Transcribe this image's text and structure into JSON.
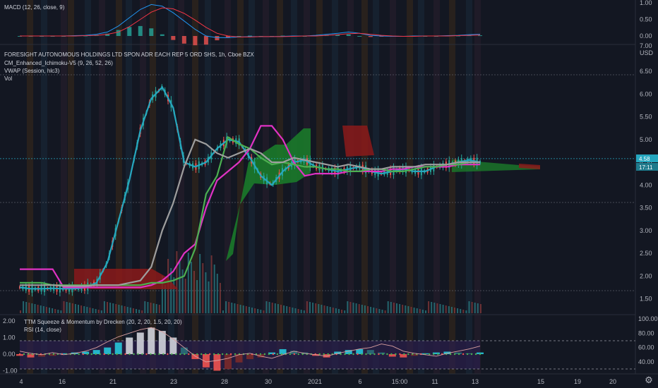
{
  "macd": {
    "label": "MACD (12, 26, close, 9)",
    "ticks": [
      "1.00",
      "0.50",
      "0.00"
    ],
    "tick_values": [
      1.0,
      0.5,
      0.0
    ]
  },
  "main": {
    "title": "FORESIGHT AUTONOMOUS HOLDINGS LTD SPON ADR EACH REP 5 ORD SHS, 1h, Cboe BZX",
    "ind1": "CM_Enhanced_Ichimoku-V5 (9, 26, 52, 26)",
    "ind2": "VWAP (Session, hlc3)",
    "ind3": "Vol",
    "axis_top": "7.00",
    "unit": "USD",
    "ticks": [
      "6.50",
      "6.00",
      "5.50",
      "5.00",
      "4.50",
      "4.00",
      "3.50",
      "3.00",
      "2.50",
      "2.00",
      "1.50"
    ],
    "tick_values": [
      6.5,
      6.0,
      5.5,
      5.0,
      4.5,
      4.0,
      3.5,
      3.0,
      2.5,
      2.0,
      1.5
    ],
    "price_tag": "4.58",
    "price_value": 4.58,
    "time_tag": "17:11"
  },
  "lower": {
    "label1": "TTM Squeeze & Momentum by Drecken (20, 2, 20, 1.5, 20, 20)",
    "label2": "RSI (14, close)",
    "left_ticks": [
      "2.00",
      "1.00",
      "0.00",
      "-1.00"
    ],
    "left_tick_values": [
      2.0,
      1.0,
      0.0,
      -1.0
    ],
    "right_ticks": [
      "100.00",
      "80.00",
      "60.00",
      "40.00"
    ],
    "right_tick_values": [
      100,
      80,
      60,
      40
    ],
    "rsi_bands": [
      70,
      30
    ]
  },
  "xaxis": [
    "4",
    "16",
    "21",
    "23",
    "28",
    "30",
    "2021",
    "6",
    "15:00",
    "11",
    "13",
    "15",
    "19",
    "20"
  ],
  "colors": {
    "background": "#131722",
    "cyan": "#26a7bf",
    "magenta": "#e032c4",
    "green": "#4caf50",
    "gray": "#9e9e9e",
    "cloud_green": "#1b7a2a",
    "cloud_red": "#8b1a1a",
    "macd_line": "#2196f3",
    "signal_line": "#f23645",
    "rsi_line": "#d9a0a0"
  },
  "chart_data": [
    {
      "type": "line",
      "title": "FORESIGHT AUTONOMOUS HOLDINGS LTD SPON ADR EACH REP 5 ORD SHS, 1h, Cboe BZX",
      "x_labels": [
        "4",
        "16",
        "21",
        "23",
        "28",
        "30",
        "2021",
        "6",
        "15:00",
        "11",
        "13",
        "15",
        "19",
        "20"
      ],
      "ylim": [
        1.3,
        7.0
      ],
      "series": [
        {
          "name": "",
          "color": "#26a7bf",
          "values": [
            1.75,
            1.72,
            1.72,
            1.73,
            1.72,
            1.72,
            1.75,
            1.85,
            2.3,
            3.2,
            4.1,
            5.2,
            5.9,
            6.15,
            5.7,
            4.5,
            4.4,
            4.5,
            4.8,
            5.0,
            4.95,
            4.6,
            4.2,
            4.0,
            4.3,
            4.5,
            4.55,
            4.4,
            4.35,
            4.3,
            4.35,
            4.4,
            4.3,
            4.25,
            4.3,
            4.35,
            4.3,
            4.3,
            4.4,
            4.45,
            4.5,
            4.55,
            4.5
          ]
        },
        {
          "name": "",
          "color": "#e032c4",
          "values": [
            2.15,
            2.15,
            2.15,
            2.15,
            1.75,
            1.75,
            1.75,
            1.75,
            1.75,
            1.75,
            1.75,
            1.75,
            1.8,
            1.9,
            2.1,
            2.5,
            2.7,
            3.5,
            4.1,
            4.3,
            4.5,
            4.8,
            5.3,
            5.3,
            5.0,
            4.5,
            4.2,
            4.25,
            4.25,
            4.25,
            4.3,
            4.3,
            4.3,
            4.3,
            4.35,
            4.35,
            4.4,
            4.4,
            4.4,
            4.4,
            4.45,
            4.45,
            4.45
          ]
        },
        {
          "name": "",
          "color": "#4caf50",
          "values": [
            1.85,
            1.85,
            1.85,
            1.8,
            1.8,
            1.8,
            1.8,
            1.8,
            1.8,
            1.8,
            1.8,
            1.8,
            1.85,
            1.85,
            1.9,
            2.0,
            2.6,
            3.8,
            4.2,
            5.05,
            4.9,
            4.8,
            4.6,
            4.45,
            4.5,
            4.45,
            4.4,
            4.4,
            4.35,
            4.35,
            4.3,
            4.3,
            4.35,
            4.35,
            4.3,
            4.3,
            4.35,
            4.4,
            4.4,
            4.45,
            4.45,
            4.5,
            4.5
          ]
        },
        {
          "name": "",
          "color": "#9e9e9e",
          "values": [
            1.8,
            1.8,
            1.8,
            1.8,
            1.78,
            1.78,
            1.78,
            1.8,
            1.8,
            1.8,
            1.85,
            1.9,
            2.2,
            3.0,
            3.6,
            4.4,
            5.0,
            4.9,
            4.7,
            4.6,
            4.7,
            4.8,
            4.7,
            4.5,
            4.5,
            4.6,
            4.55,
            4.5,
            4.45,
            4.4,
            4.45,
            4.4,
            4.35,
            4.35,
            4.4,
            4.4,
            4.4,
            4.45,
            4.45,
            4.45,
            4.5,
            4.5,
            4.5
          ]
        }
      ]
    },
    {
      "type": "line",
      "title": "MACD (12, 26, close, 9)",
      "ylim": [
        -0.15,
        1.0
      ],
      "series": [
        {
          "name": "",
          "color": "#2196f3",
          "values": [
            0.0,
            0.0,
            0.0,
            0.0,
            0.0,
            0.01,
            0.02,
            0.05,
            0.12,
            0.3,
            0.55,
            0.8,
            0.95,
            0.9,
            0.7,
            0.45,
            0.2,
            0.0,
            -0.05,
            -0.05,
            -0.03,
            -0.02,
            -0.02,
            -0.02,
            -0.01,
            0.0,
            0.0,
            0.02,
            0.05,
            0.08,
            0.12,
            0.08,
            0.02,
            0.0,
            -0.01,
            -0.01,
            0.0,
            0.0,
            0.0,
            0.01,
            0.02,
            0.04,
            0.05
          ]
        },
        {
          "name": "",
          "color": "#f23645",
          "values": [
            0.0,
            0.0,
            0.0,
            0.0,
            0.0,
            0.0,
            0.01,
            0.02,
            0.05,
            0.12,
            0.28,
            0.5,
            0.72,
            0.85,
            0.82,
            0.68,
            0.48,
            0.26,
            0.08,
            0.0,
            -0.03,
            -0.03,
            -0.02,
            -0.02,
            -0.02,
            -0.01,
            0.0,
            0.0,
            0.02,
            0.04,
            0.07,
            0.08,
            0.05,
            0.02,
            0.0,
            -0.01,
            -0.01,
            0.0,
            0.0,
            0.0,
            0.01,
            0.02,
            0.03
          ]
        }
      ]
    },
    {
      "type": "line",
      "title": "RSI (14, close)",
      "ylim": [
        25,
        100
      ],
      "series": [
        {
          "name": "",
          "color": "#d9a0a0",
          "values": [
            55,
            52,
            50,
            53,
            50,
            52,
            55,
            60,
            68,
            75,
            80,
            85,
            88,
            82,
            72,
            60,
            48,
            40,
            42,
            45,
            50,
            52,
            48,
            45,
            50,
            55,
            52,
            50,
            48,
            52,
            55,
            58,
            60,
            65,
            62,
            55,
            52,
            50,
            48,
            52,
            55,
            58,
            62
          ]
        }
      ]
    },
    {
      "type": "bar",
      "title": "TTM Squeeze & Momentum by Drecken (20, 2, 20, 1.5, 20, 20)",
      "ylim": [
        -1.2,
        2.0
      ],
      "values": [
        -0.1,
        -0.2,
        -0.15,
        -0.1,
        0.05,
        0.1,
        0.15,
        0.25,
        0.4,
        0.7,
        1.0,
        1.3,
        1.6,
        1.4,
        1.0,
        0.4,
        -0.3,
        -0.8,
        -1.0,
        -0.9,
        -0.5,
        -0.3,
        -0.2,
        0.1,
        0.3,
        0.2,
        0.1,
        -0.1,
        -0.2,
        0.15,
        0.25,
        0.3,
        0.25,
        0.1,
        -0.15,
        -0.2,
        -0.1,
        0.05,
        0.1,
        0.15,
        0.1,
        0.05,
        0.1
      ]
    }
  ]
}
